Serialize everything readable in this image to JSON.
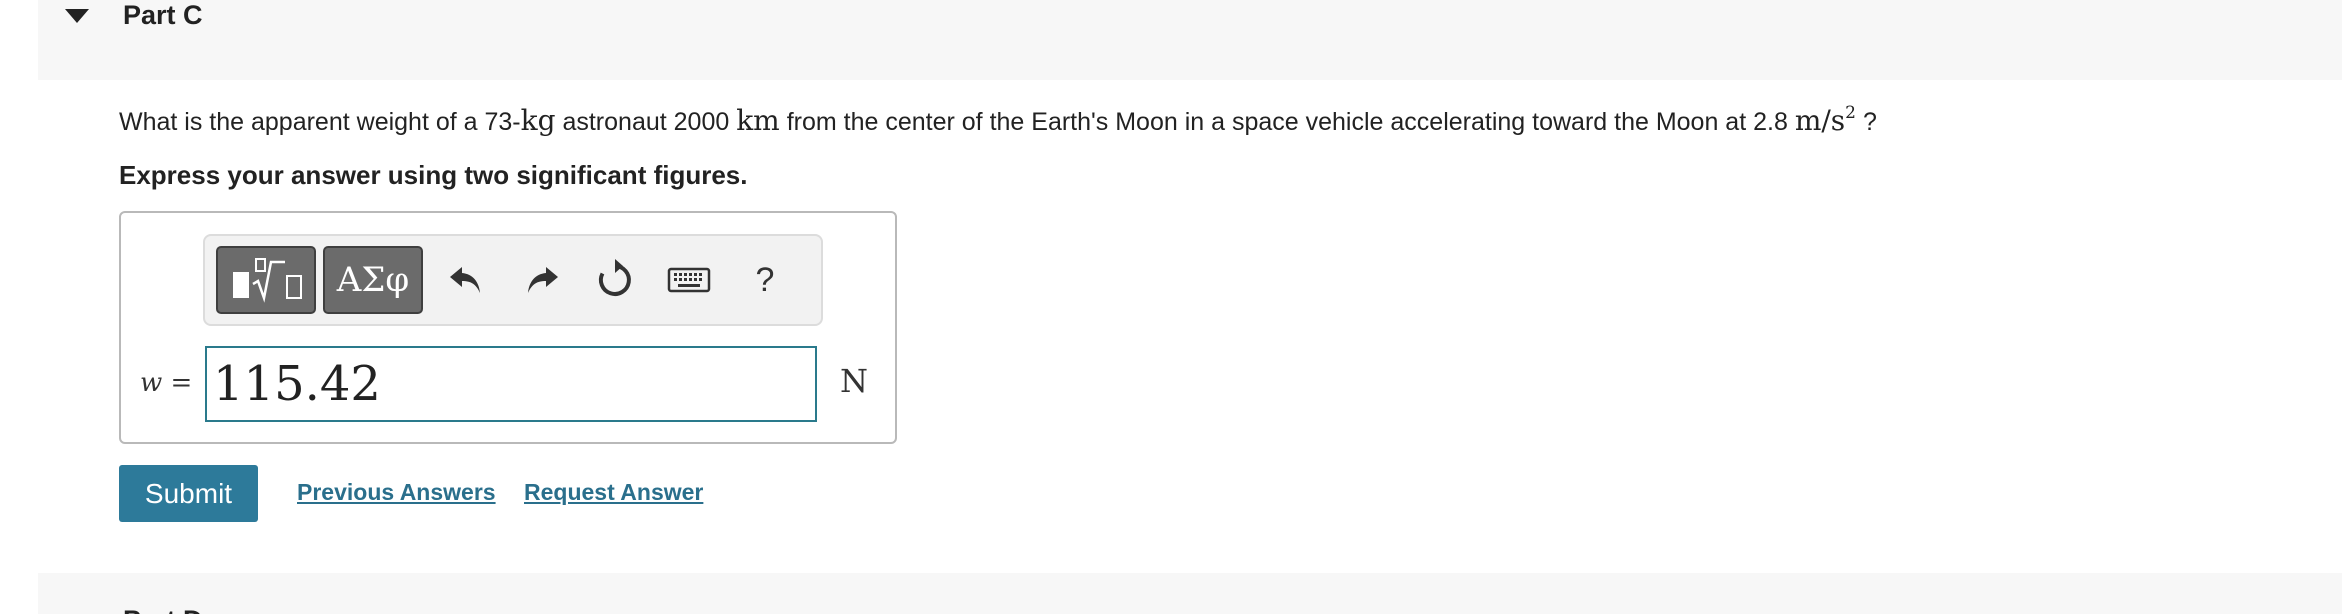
{
  "part": {
    "title": "Part C"
  },
  "question": {
    "text_before": "What is the apparent weight of a 73-",
    "mass_unit": "kg",
    "text_mid1": " astronaut 2000 ",
    "dist_unit": "km",
    "text_mid2": " from the center of the Earth's Moon in a space vehicle accelerating toward the Moon at 2.8 ",
    "accel_unit": "m/s",
    "accel_exp": "2",
    "text_end": " ?"
  },
  "instruction": "Express your answer using two significant figures.",
  "toolbar": {
    "symbols_label": "ΑΣφ",
    "help_label": "?"
  },
  "answer": {
    "variable": "w",
    "equals": " =",
    "value": "115.42",
    "unit": "N"
  },
  "actions": {
    "submit_label": "Submit",
    "previous_answers_label": "Previous Answers",
    "request_answer_label": "Request Answer"
  },
  "next_part": {
    "title": "Part D"
  }
}
